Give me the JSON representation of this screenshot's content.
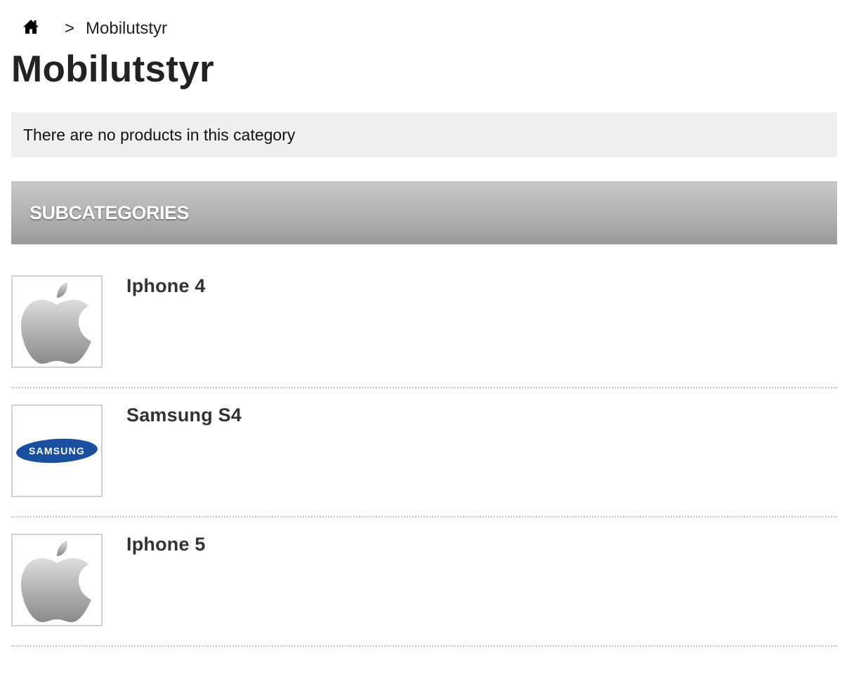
{
  "breadcrumb": {
    "home_icon": "home-icon",
    "separator": ">",
    "current": "Mobilutstyr"
  },
  "page_title": "Mobilutstyr",
  "notice": "There are no products in this category",
  "subcategories": {
    "heading": "SUBCATEGORIES",
    "items": [
      {
        "name": "Iphone 4",
        "logo": "apple-logo"
      },
      {
        "name": "Samsung S4",
        "logo": "samsung-logo"
      },
      {
        "name": "Iphone 5",
        "logo": "apple-logo"
      }
    ]
  },
  "colors": {
    "notice_bg": "#efefef",
    "header_gradient_top": "#c8c8c8",
    "header_gradient_bottom": "#9a9a9a",
    "samsung_blue": "#1a4fa0"
  },
  "logo_texts": {
    "samsung": "SAMSUNG"
  }
}
